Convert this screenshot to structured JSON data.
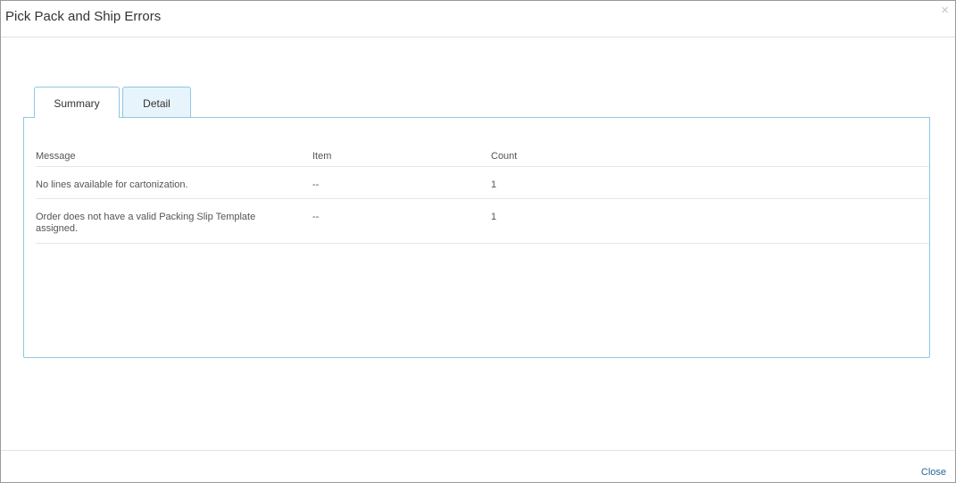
{
  "dialog": {
    "title": "Pick Pack and Ship Errors",
    "close_icon": "×"
  },
  "tabs": [
    {
      "label": "Summary",
      "active": true
    },
    {
      "label": "Detail",
      "active": false
    }
  ],
  "grid": {
    "columns": [
      "Message",
      "Item",
      "Count"
    ],
    "rows": [
      {
        "message": "No lines available for cartonization.",
        "item": "--",
        "count": "1"
      },
      {
        "message": "Order does not have a valid Packing Slip Template assigned.",
        "item": "--",
        "count": "1"
      }
    ]
  },
  "footer": {
    "close_label": "Close"
  },
  "colors": {
    "tab_border": "#8dc7e4",
    "tab_inactive_bg": "#e8f4fb",
    "link": "#2a6496"
  }
}
